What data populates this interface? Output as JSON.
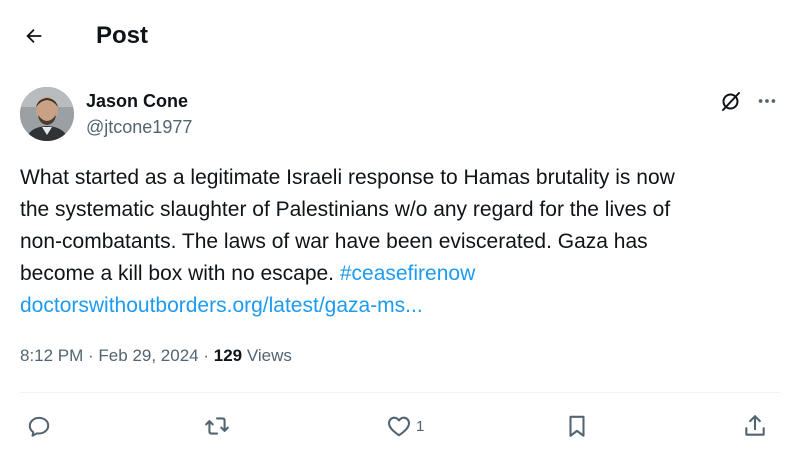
{
  "header": {
    "title": "Post",
    "back_icon": "arrow-left-icon"
  },
  "author": {
    "name": "Jason Cone",
    "handle": "@jtcone1977",
    "avatar_icon": "avatar"
  },
  "tweet": {
    "lines": [
      "What started as a legitimate Israeli response to Hamas brutality is now",
      "the systematic slaughter of Palestinians w/o any regard for the lives of",
      "non-combatants. The laws of war have been eviscerated. Gaza has",
      "become a kill box with no escape. "
    ],
    "hashtag": "#ceasefirenow",
    "link": "doctorswithoutborders.org/latest/gaza-ms..."
  },
  "meta": {
    "time": "8:12 PM",
    "separator": " · ",
    "date": "Feb 29, 2024",
    "views_count": "129",
    "views_label": " Views"
  },
  "actions": {
    "reply_icon": "reply-icon",
    "repost_icon": "repost-icon",
    "like_icon": "heart-icon",
    "like_count": "1",
    "bookmark_icon": "bookmark-icon",
    "share_icon": "share-icon"
  },
  "colors": {
    "text": "#0f1419",
    "secondary": "#536471",
    "link": "#1d9bf0",
    "divider": "#eff3f4"
  }
}
